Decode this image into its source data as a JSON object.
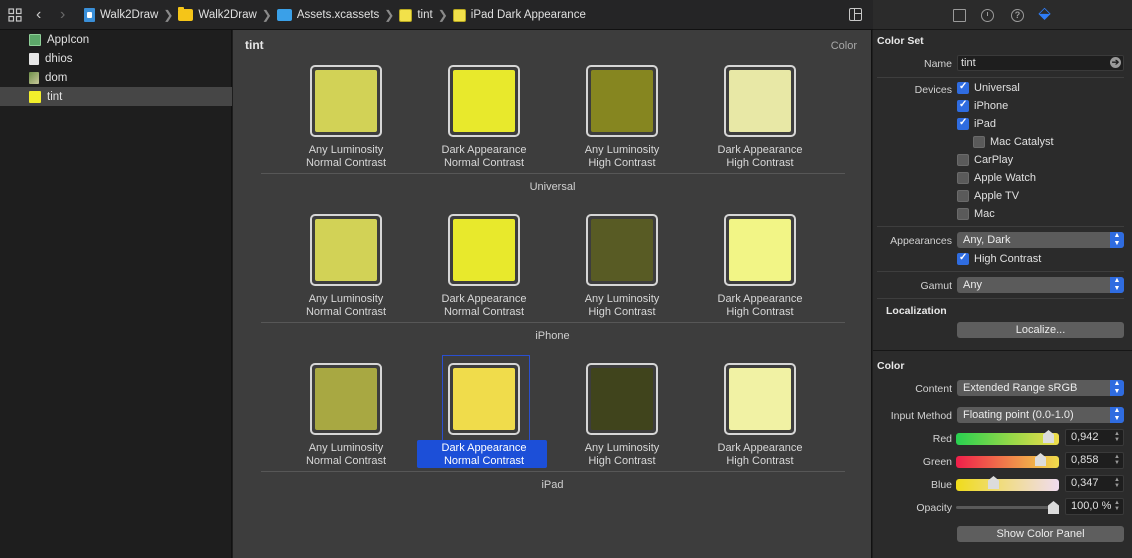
{
  "breadcrumb": [
    {
      "label": "Walk2Draw",
      "icon": "swift-file-icon"
    },
    {
      "label": "Walk2Draw",
      "icon": "folder-icon"
    },
    {
      "label": "Assets.xcassets",
      "icon": "asset-catalog-icon"
    },
    {
      "label": "tint",
      "icon": "color-set-icon"
    },
    {
      "label": "iPad Dark Appearance",
      "icon": "color-set-icon"
    }
  ],
  "navigator": {
    "items": [
      {
        "label": "AppIcon",
        "color": "#5da86a"
      },
      {
        "label": "dhios",
        "color": "#dcdcdc"
      },
      {
        "label": "dom",
        "color": "#8c9a6a"
      },
      {
        "label": "tint",
        "color": "#f2ef2c"
      }
    ],
    "selected_index": 3
  },
  "editor": {
    "title": "tint",
    "kind": "Color",
    "groups": [
      {
        "name": "Universal",
        "wells": [
          {
            "line1": "Any Luminosity",
            "line2": "Normal Contrast",
            "color": "#d2d256"
          },
          {
            "line1": "Dark Appearance",
            "line2": "Normal Contrast",
            "color": "#e8e92c"
          },
          {
            "line1": "Any Luminosity",
            "line2": "High Contrast",
            "color": "#868620"
          },
          {
            "line1": "Dark Appearance",
            "line2": "High Contrast",
            "color": "#e8e8a6"
          }
        ]
      },
      {
        "name": "iPhone",
        "wells": [
          {
            "line1": "Any Luminosity",
            "line2": "Normal Contrast",
            "color": "#d2d256"
          },
          {
            "line1": "Dark Appearance",
            "line2": "Normal Contrast",
            "color": "#e8e92c"
          },
          {
            "line1": "Any Luminosity",
            "line2": "High Contrast",
            "color": "#585b24"
          },
          {
            "line1": "Dark Appearance",
            "line2": "High Contrast",
            "color": "#f2f586"
          }
        ]
      },
      {
        "name": "iPad",
        "wells": [
          {
            "line1": "Any Luminosity",
            "line2": "Normal Contrast",
            "color": "#a8a842"
          },
          {
            "line1": "Dark Appearance",
            "line2": "Normal Contrast",
            "color": "#f0dc4b"
          },
          {
            "line1": "Any Luminosity",
            "line2": "High Contrast",
            "color": "#40441c"
          },
          {
            "line1": "Dark Appearance",
            "line2": "High Contrast",
            "color": "#f1f2a4"
          }
        ],
        "selected_index": 1
      }
    ]
  },
  "inspector": {
    "color_set": {
      "title": "Color Set",
      "name_label": "Name",
      "name_value": "tint",
      "devices_label": "Devices",
      "devices": [
        {
          "label": "Universal",
          "checked": true
        },
        {
          "label": "iPhone",
          "checked": true
        },
        {
          "label": "iPad",
          "checked": true
        },
        {
          "label": "Mac Catalyst",
          "checked": false
        },
        {
          "label": "CarPlay",
          "checked": false
        },
        {
          "label": "Apple Watch",
          "checked": false
        },
        {
          "label": "Apple TV",
          "checked": false
        },
        {
          "label": "Mac",
          "checked": false
        }
      ],
      "appearances_label": "Appearances",
      "appearances_value": "Any, Dark",
      "high_contrast_label": "High Contrast",
      "high_contrast_checked": true,
      "gamut_label": "Gamut",
      "gamut_value": "Any"
    },
    "localization": {
      "title": "Localization",
      "button": "Localize..."
    },
    "color": {
      "title": "Color",
      "content_label": "Content",
      "content_value": "Extended Range sRGB",
      "input_method_label": "Input Method",
      "input_method_value": "Floating point (0.0-1.0)",
      "channels": [
        {
          "label": "Red",
          "value": "0,942",
          "fraction": 0.942,
          "gradient": "linear-gradient(90deg,#28d050,#98d848 55%,#f0dc4b)"
        },
        {
          "label": "Green",
          "value": "0,858",
          "fraction": 0.858,
          "gradient": "linear-gradient(90deg,#f01e4a,#f0884a 55%,#f0dc4b)"
        },
        {
          "label": "Blue",
          "value": "0,347",
          "fraction": 0.347,
          "gradient": "linear-gradient(90deg,#f0dc1a,#f0dc80 45%,#f0dcf0)"
        }
      ],
      "opacity_label": "Opacity",
      "opacity_value": "100,0 %",
      "opacity_fraction": 1.0,
      "show_panel_button": "Show Color Panel"
    }
  }
}
